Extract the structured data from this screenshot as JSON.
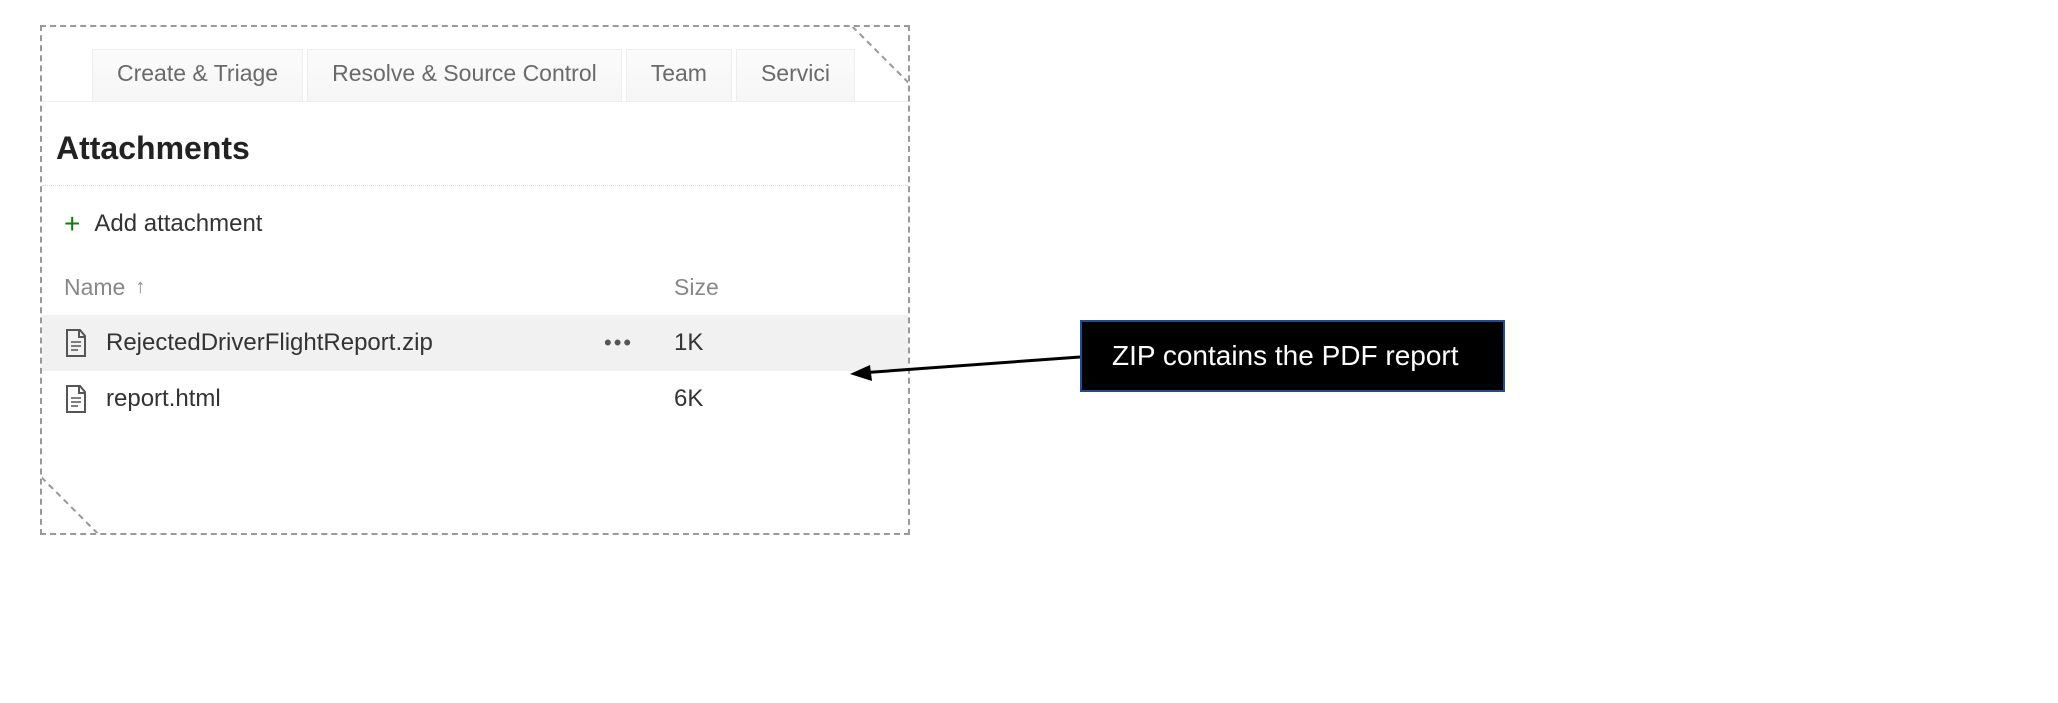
{
  "tabs": [
    {
      "label": "Create & Triage"
    },
    {
      "label": "Resolve & Source Control"
    },
    {
      "label": "Team"
    },
    {
      "label": "Servici"
    }
  ],
  "section": {
    "title": "Attachments"
  },
  "add": {
    "label": "Add attachment"
  },
  "columns": {
    "name": "Name",
    "size": "Size",
    "sort_dir": "asc"
  },
  "files": [
    {
      "icon": "file-icon",
      "name": "RejectedDriverFlightReport.zip",
      "size": "1K",
      "selected": true,
      "menu": "•••"
    },
    {
      "icon": "file-icon",
      "name": "report.html",
      "size": "6K",
      "selected": false,
      "menu": ""
    }
  ],
  "annotation": {
    "text": "ZIP contains the PDF report"
  }
}
